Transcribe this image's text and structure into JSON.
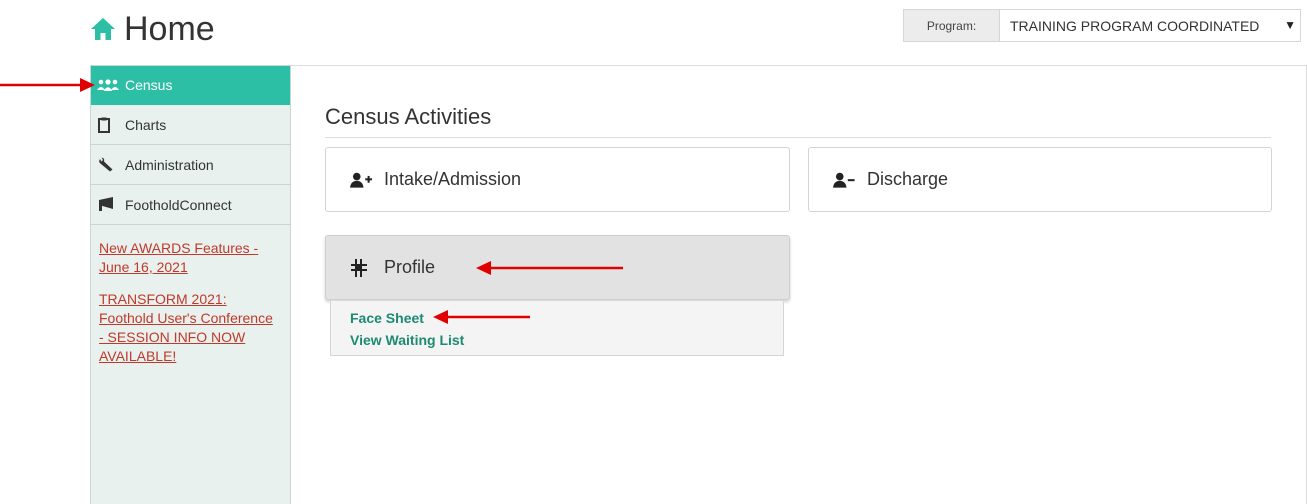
{
  "header": {
    "title": "Home",
    "title_icon": "home-icon",
    "program_label": "Program:",
    "program_value": "TRAINING PROGRAM COORDINATED"
  },
  "sidebar": {
    "items": [
      {
        "label": "Census",
        "icon": "users-icon",
        "active": true
      },
      {
        "label": "Charts",
        "icon": "clipboard-icon",
        "active": false
      },
      {
        "label": "Administration",
        "icon": "wrench-icon",
        "active": false
      },
      {
        "label": "FootholdConnect",
        "icon": "megaphone-icon",
        "active": false
      }
    ],
    "news": [
      {
        "text": "New AWARDS Features - June 16, 2021"
      },
      {
        "text": "TRANSFORM 2021: Foothold User's Conference - SESSION INFO NOW AVAILABLE!"
      }
    ]
  },
  "main": {
    "section_title": "Census Activities",
    "cards": {
      "intake": {
        "label": "Intake/Admission",
        "icon": "user-plus-icon"
      },
      "discharge": {
        "label": "Discharge",
        "icon": "user-minus-icon"
      },
      "profile": {
        "label": "Profile",
        "icon": "profile-icon"
      }
    },
    "profile_submenu": [
      {
        "label": "Face Sheet"
      },
      {
        "label": "View Waiting List"
      }
    ]
  },
  "colors": {
    "accent": "#2dbfa6",
    "link_red": "#c0392b",
    "submenu_link": "#1d8a73",
    "annotation_arrow": "#e00000"
  }
}
